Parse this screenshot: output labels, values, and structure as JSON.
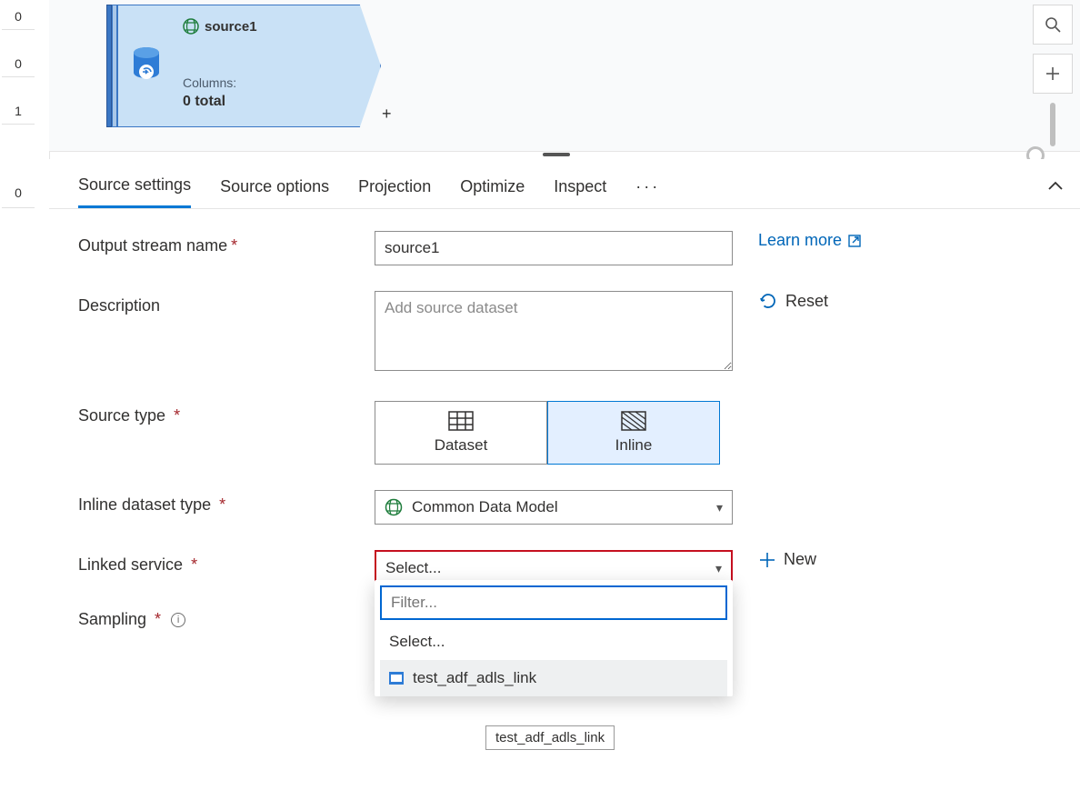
{
  "leftRail": {
    "n0": "0",
    "n1": "0",
    "n2": "1",
    "n3": "0"
  },
  "node": {
    "title": "source1",
    "columnsLabel": "Columns:",
    "columnsValue": "0 total"
  },
  "tabs": {
    "t0": "Source settings",
    "t1": "Source options",
    "t2": "Projection",
    "t3": "Optimize",
    "t4": "Inspect"
  },
  "form": {
    "outputStreamLabel": "Output stream name",
    "outputStreamValue": "source1",
    "descriptionLabel": "Description",
    "descriptionPlaceholder": "Add source dataset",
    "sourceTypeLabel": "Source type",
    "sourceTypeDataset": "Dataset",
    "sourceTypeInline": "Inline",
    "inlineDatasetTypeLabel": "Inline dataset type",
    "inlineDatasetTypeValue": "Common Data Model",
    "linkedServiceLabel": "Linked service",
    "linkedServicePlaceholder": "Select...",
    "samplingLabel": "Sampling"
  },
  "side": {
    "learnMore": "Learn more",
    "reset": "Reset",
    "new": "New"
  },
  "dropdown": {
    "filterPlaceholder": "Filter...",
    "placeholder": "Select...",
    "option1": "test_adf_adls_link"
  },
  "tooltip": "test_adf_adls_link"
}
